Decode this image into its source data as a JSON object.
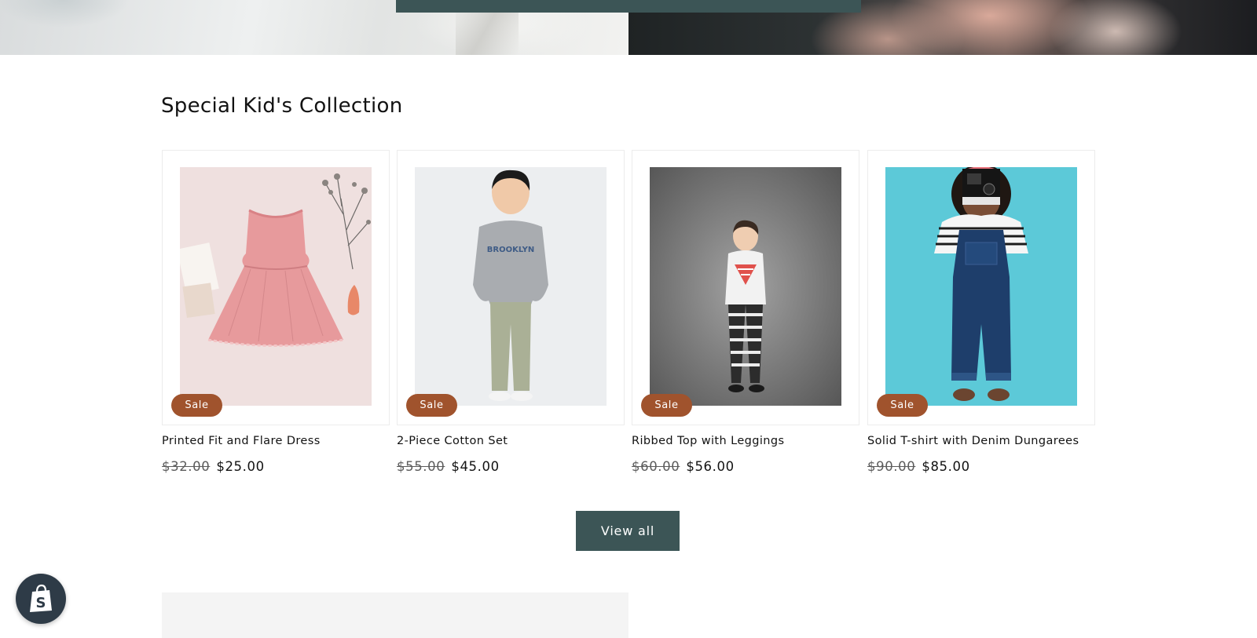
{
  "section": {
    "title": "Special Kid's Collection"
  },
  "products": [
    {
      "name": "Printed Fit and Flare Dress",
      "badge": "Sale",
      "compare_price": "$32.00",
      "price": "$25.00"
    },
    {
      "name": "2-Piece Cotton Set",
      "badge": "Sale",
      "compare_price": "$55.00",
      "price": "$45.00"
    },
    {
      "name": "Ribbed Top with Leggings",
      "badge": "Sale",
      "compare_price": "$60.00",
      "price": "$56.00"
    },
    {
      "name": "Solid T-shirt with Denim Dungarees",
      "badge": "Sale",
      "compare_price": "$90.00",
      "price": "$85.00"
    }
  ],
  "actions": {
    "view_all_label": "View all"
  },
  "icons": {
    "shopify": "shopify-bag-icon"
  },
  "colors": {
    "accent": "#3c5556",
    "sale_badge": "#a0532d"
  }
}
